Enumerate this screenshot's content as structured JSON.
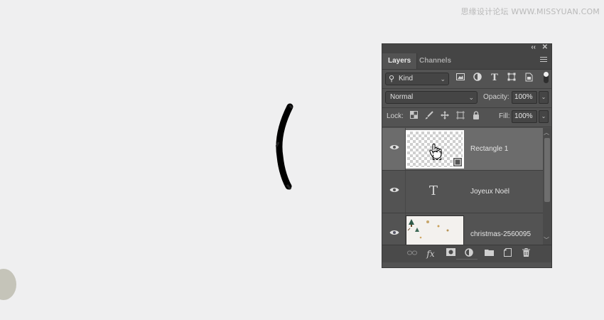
{
  "watermark": "思缘设计论坛 WWW.MISSYUAN.COM",
  "panel": {
    "collapse_glyph": "‹‹",
    "close_glyph": "✕",
    "tabs": [
      {
        "label": "Layers",
        "active": true
      },
      {
        "label": "Channels",
        "active": false
      }
    ],
    "filter": {
      "search_glyph": "⚲",
      "kind_label": "Kind",
      "icons": [
        "image-filter-icon",
        "adjustment-filter-icon",
        "type-filter-icon",
        "shape-filter-icon",
        "smart-object-filter-icon"
      ],
      "type_glyph": "T"
    },
    "blend_mode": "Normal",
    "opacity_label": "Opacity:",
    "opacity_value": "100%",
    "lock_label": "Lock:",
    "fill_label": "Fill:",
    "fill_value": "100%",
    "layers": [
      {
        "name": "Rectangle 1",
        "kind": "shape",
        "selected": true,
        "visible": true
      },
      {
        "name": "Joyeux Noël",
        "kind": "text",
        "selected": false,
        "visible": true,
        "glyph": "T"
      },
      {
        "name": "christmas-2560095",
        "kind": "image",
        "selected": false,
        "visible": true
      }
    ],
    "bottom_icons": [
      "link-layers-icon",
      "fx-icon",
      "add-mask-icon",
      "new-adjustment-icon",
      "new-group-icon",
      "new-layer-icon",
      "delete-layer-icon"
    ],
    "fx_label": "fx"
  },
  "colors": {
    "canvas": "#efeff0",
    "panel_bg": "#535353",
    "selected_row": "#6c6c6c"
  }
}
